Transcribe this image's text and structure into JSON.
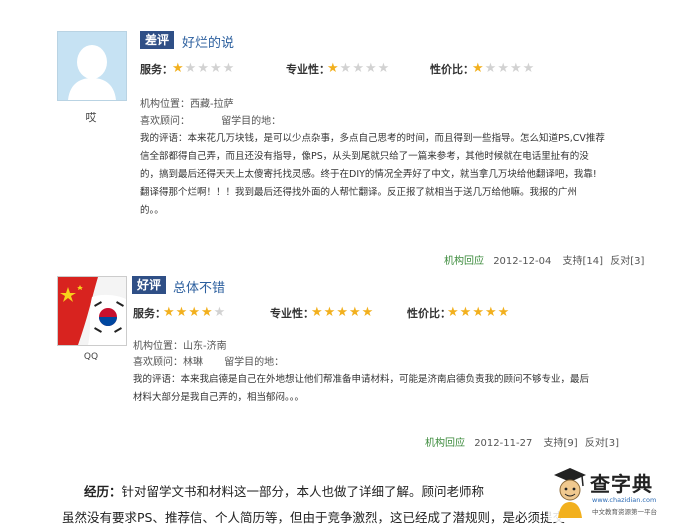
{
  "review1": {
    "user": "哎",
    "badge": "差评",
    "title": "好烂的说",
    "ratings": [
      {
        "label": "服务：",
        "stars": 1
      },
      {
        "label": "专业性：",
        "stars": 1
      },
      {
        "label": "性价比：",
        "stars": 1
      }
    ],
    "location": "机构位置：西藏-拉萨",
    "consultant_label": "喜欢顾问：",
    "destination_label": "留学目的地：",
    "comment_lines": [
      "我的评语：本来花几万块钱，是可以少点杂事，多点自己思考的时间，而且得到一些指导。怎么知道PS,CV推荐",
      "信全部都得自己弄，而且还没有指导，像PS，从头到尾就只给了一篇来参考，其他时候就在电话里扯有的没",
      "的，搞到最后还得天天上太傻寄托找灵感。终于在DIY的情况全弄好了中文，就当拿几万块给他翻译吧，我靠!",
      "翻译得那个烂啊！！！我到最后还得找外面的人帮忙翻译。反正报了就相当于送几万给他嘛。我报的广州",
      "的。。"
    ],
    "reply": "机构回应",
    "date": "2012-12-04",
    "support": "支持[14]",
    "oppose": "反对[3]"
  },
  "review2": {
    "user": "QQ",
    "badge": "好评",
    "title": "总体不错",
    "ratings": [
      {
        "label": "服务：",
        "stars": 4
      },
      {
        "label": "专业性：",
        "stars": 5
      },
      {
        "label": "性价比：",
        "stars": 5
      }
    ],
    "location": "机构位置：山东-济南",
    "consultant_label": "喜欢顾问：林琳",
    "destination_label": "留学目的地：",
    "comment_lines": [
      "我的评语：本来我启德是自己在外地想让他们帮准备申请材料，可能是济南启德负责我的顾问不够专业，最后",
      "材料大部分是我自己弄的，相当郁闷。。。"
    ],
    "reply": "机构回应",
    "date": "2012-11-27",
    "support": "支持[9]",
    "oppose": "反对[3]"
  },
  "bottom": {
    "heading": "经历：",
    "line1": "针对留学文书和材料这一部分，本人也做了详细了解。顾问老师称",
    "line2": "虽然没有要求PS、推荐信、个人简历等，但由于竞争激烈，这已经成了潜规则，是必须提交"
  },
  "watermark": {
    "name": "查字典",
    "url": "www.chazidian.com",
    "tagline": "中文教育资源第一平台"
  }
}
